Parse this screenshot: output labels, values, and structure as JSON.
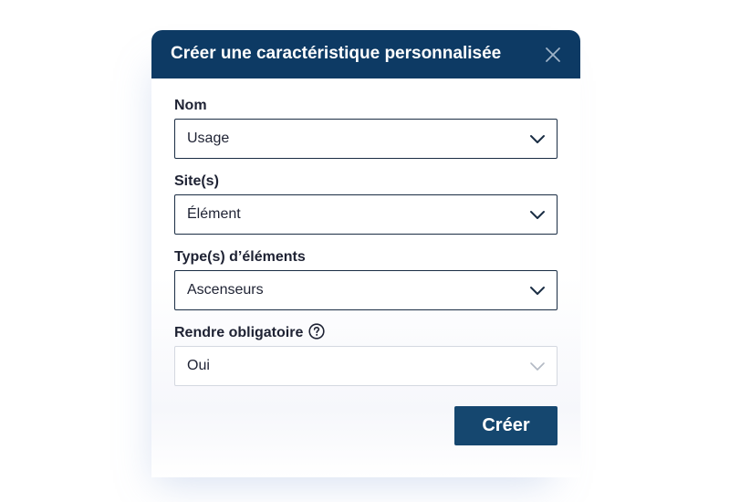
{
  "modal": {
    "title": "Créer une caractéristique personnalisée",
    "header_color": "#0d3a64",
    "close_icon": "close-icon"
  },
  "fields": {
    "nom": {
      "label": "Nom",
      "value": "Usage"
    },
    "sites": {
      "label": "Site(s)",
      "value": "Élément"
    },
    "types": {
      "label": "Type(s) d’éléments",
      "value": "Ascenseurs"
    },
    "obligatoire": {
      "label": "Rendre obligatoire",
      "value": "Oui",
      "help_icon": "help-circle-icon"
    }
  },
  "actions": {
    "create_label": "Créer",
    "create_color": "#15476f"
  }
}
